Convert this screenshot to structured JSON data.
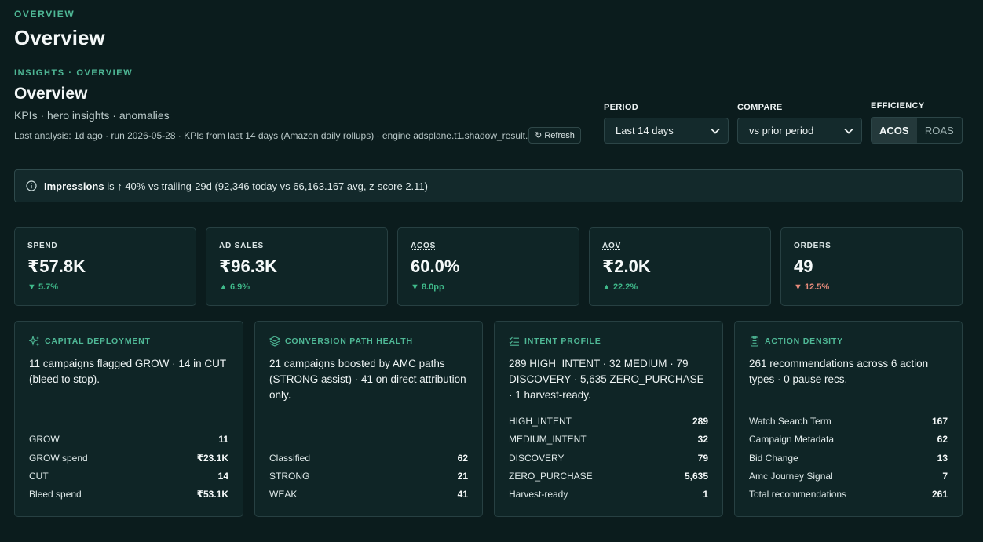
{
  "header": {
    "eyebrow": "OVERVIEW",
    "title": "Overview",
    "section_eyebrow": "INSIGHTS · OVERVIEW",
    "section_title": "Overview",
    "subtitle": "KPIs · hero insights · anomalies",
    "meta": "Last analysis: 1d ago · run 2026-05-28 · KPIs from last 14 days (Amazon daily rollups) · engine adsplane.t1.shadow_result.v2",
    "refresh_label": "Refresh"
  },
  "controls": {
    "period_label": "PERIOD",
    "period_value": "Last 14 days",
    "compare_label": "COMPARE",
    "compare_value": "vs prior period",
    "efficiency_label": "EFFICIENCY",
    "efficiency_options": [
      "ACOS",
      "ROAS"
    ],
    "efficiency_selected": "ACOS"
  },
  "alert": {
    "metric": "Impressions",
    "text": "is ↑ 40% vs trailing-29d (92,346 today vs 66,163.167 avg, z-score 2.11)"
  },
  "kpis": [
    {
      "label": "SPEND",
      "value": "₹57.8K",
      "delta": "▼ 5.7%",
      "tone": "good"
    },
    {
      "label": "AD SALES",
      "value": "₹96.3K",
      "delta": "▲ 6.9%",
      "tone": "good"
    },
    {
      "label": "ACOS",
      "value": "60.0%",
      "delta": "▼ 8.0pp",
      "tone": "good"
    },
    {
      "label": "AOV",
      "value": "₹2.0K",
      "delta": "▲ 22.2%",
      "tone": "good"
    },
    {
      "label": "ORDERS",
      "value": "49",
      "delta": "▼ 12.5%",
      "tone": "bad"
    }
  ],
  "cards": [
    {
      "title": "CAPITAL DEPLOYMENT",
      "icon": "sparkle-icon",
      "text": "11 campaigns flagged GROW · 14 in CUT (bleed to stop).",
      "rows": [
        {
          "label": "GROW",
          "value": "11"
        },
        {
          "label": "GROW spend",
          "value": "₹23.1K"
        },
        {
          "label": "CUT",
          "value": "14"
        },
        {
          "label": "Bleed spend",
          "value": "₹53.1K"
        }
      ]
    },
    {
      "title": "CONVERSION PATH HEALTH",
      "icon": "layers-icon",
      "text": "21 campaigns boosted by AMC paths (STRONG assist) · 41 on direct attribution only.",
      "rows": [
        {
          "label": "Classified",
          "value": "62"
        },
        {
          "label": "STRONG",
          "value": "21"
        },
        {
          "label": "WEAK",
          "value": "41"
        }
      ]
    },
    {
      "title": "INTENT PROFILE",
      "icon": "list-check-icon",
      "text": "289 HIGH_INTENT · 32 MEDIUM · 79 DISCOVERY · 5,635 ZERO_PURCHASE · 1 harvest-ready.",
      "rows": [
        {
          "label": "HIGH_INTENT",
          "value": "289"
        },
        {
          "label": "MEDIUM_INTENT",
          "value": "32"
        },
        {
          "label": "DISCOVERY",
          "value": "79"
        },
        {
          "label": "ZERO_PURCHASE",
          "value": "5,635"
        },
        {
          "label": "Harvest-ready",
          "value": "1"
        }
      ]
    },
    {
      "title": "ACTION DENSITY",
      "icon": "clipboard-icon",
      "text": "261 recommendations across 6 action types · 0 pause recs.",
      "rows": [
        {
          "label": "Watch Search Term",
          "value": "167"
        },
        {
          "label": "Campaign Metadata",
          "value": "62"
        },
        {
          "label": "Bid Change",
          "value": "13"
        },
        {
          "label": "Amc Journey Signal",
          "value": "7"
        },
        {
          "label": "Total recommendations",
          "value": "261"
        }
      ]
    }
  ]
}
